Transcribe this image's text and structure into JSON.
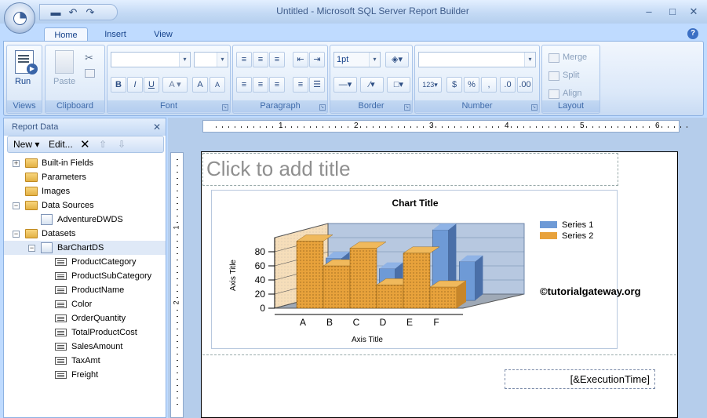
{
  "window": {
    "title": "Untitled - Microsoft SQL Server Report Builder",
    "minimize": "–",
    "maximize": "□",
    "close": "✕"
  },
  "qat": {
    "save_icon": "save-icon",
    "undo_icon": "undo-icon",
    "redo_icon": "redo-icon"
  },
  "tabs": [
    "Home",
    "Insert",
    "View"
  ],
  "ribbon": {
    "views": {
      "label": "Views",
      "run": "Run"
    },
    "clipboard": {
      "label": "Clipboard",
      "paste": "Paste"
    },
    "font": {
      "label": "Font",
      "bold": "B",
      "italic": "I",
      "underline": "U",
      "grow": "A",
      "shrink": "A"
    },
    "paragraph": {
      "label": "Paragraph"
    },
    "border": {
      "label": "Border",
      "width": "1pt"
    },
    "number": {
      "label": "Number",
      "placeholder_btn": "123",
      "currency": "$",
      "percent": "%"
    },
    "layout": {
      "label": "Layout",
      "merge": "Merge",
      "split": "Split",
      "align": "Align"
    }
  },
  "report_data": {
    "title": "Report Data",
    "new": "New",
    "edit": "Edit...",
    "items": [
      {
        "label": "Built-in Fields",
        "level": 0,
        "expander": "+",
        "icon": "folder"
      },
      {
        "label": "Parameters",
        "level": 0,
        "expander": "",
        "icon": "folder"
      },
      {
        "label": "Images",
        "level": 0,
        "expander": "",
        "icon": "folder"
      },
      {
        "label": "Data Sources",
        "level": 0,
        "expander": "−",
        "icon": "folder"
      },
      {
        "label": "AdventureDWDS",
        "level": 1,
        "expander": "",
        "icon": "datasource"
      },
      {
        "label": "Datasets",
        "level": 0,
        "expander": "−",
        "icon": "folder"
      },
      {
        "label": "BarChartDS",
        "level": 1,
        "expander": "−",
        "icon": "dataset"
      },
      {
        "label": "ProductCategory",
        "level": 2,
        "expander": "",
        "icon": "field"
      },
      {
        "label": "ProductSubCategory",
        "level": 2,
        "expander": "",
        "icon": "field"
      },
      {
        "label": "ProductName",
        "level": 2,
        "expander": "",
        "icon": "field"
      },
      {
        "label": "Color",
        "level": 2,
        "expander": "",
        "icon": "field"
      },
      {
        "label": "OrderQuantity",
        "level": 2,
        "expander": "",
        "icon": "field"
      },
      {
        "label": "TotalProductCost",
        "level": 2,
        "expander": "",
        "icon": "field"
      },
      {
        "label": "SalesAmount",
        "level": 2,
        "expander": "",
        "icon": "field"
      },
      {
        "label": "TaxAmt",
        "level": 2,
        "expander": "",
        "icon": "field"
      },
      {
        "label": "Freight",
        "level": 2,
        "expander": "",
        "icon": "field"
      }
    ]
  },
  "ruler": {
    "marks": [
      "1",
      "2",
      "3",
      "4",
      "5",
      "6"
    ],
    "vmarks": [
      "1",
      "2"
    ]
  },
  "report": {
    "title_placeholder": "Click to add title",
    "execution_time": "[&ExecutionTime]",
    "watermark": "©tutorialgateway.org"
  },
  "chart_data": {
    "type": "bar",
    "title": "Chart Title",
    "xlabel": "Axis Title",
    "ylabel": "Axis Title",
    "categories": [
      "A",
      "B",
      "C",
      "D",
      "E",
      "F"
    ],
    "ylim": [
      0,
      100
    ],
    "yticks": [
      0,
      20,
      40,
      60,
      80
    ],
    "series": [
      {
        "name": "Series 1",
        "values": [
          60,
          70,
          45,
          40,
          100,
          55
        ],
        "color": "#6e9ad6"
      },
      {
        "name": "Series 2",
        "values": [
          95,
          60,
          85,
          33,
          78,
          30
        ],
        "color": "#e8a23b"
      }
    ],
    "legend": "top-right",
    "style": "3d-clustered-column"
  }
}
